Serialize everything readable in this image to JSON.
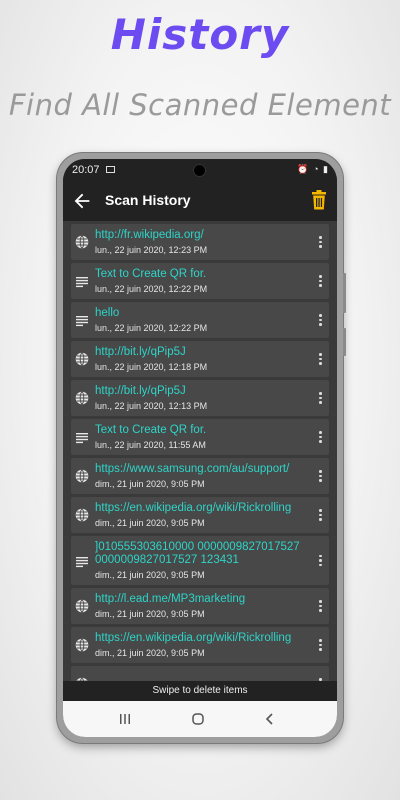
{
  "promo": {
    "title": "History",
    "subtitle": "Find All Scanned Element"
  },
  "status_bar": {
    "time": "20:07",
    "right": "⏰ ◔ ▮"
  },
  "app_bar": {
    "title": "Scan History",
    "accent_color": "#f5b800"
  },
  "colors": {
    "item_text": "#2ed4c8",
    "promo_title": "#6c4cf0"
  },
  "history": [
    {
      "icon": "globe-icon",
      "text": "http://fr.wikipedia.org/",
      "date": "lun., 22 juin 2020, 12:23 PM"
    },
    {
      "icon": "text-lines-icon",
      "text": "Text to Create QR for.",
      "date": "lun., 22 juin 2020, 12:22 PM"
    },
    {
      "icon": "text-lines-icon",
      "text": "hello",
      "date": "lun., 22 juin 2020, 12:22 PM"
    },
    {
      "icon": "globe-icon",
      "text": "http://bit.ly/qPip5J",
      "date": "lun., 22 juin 2020, 12:18 PM"
    },
    {
      "icon": "globe-icon",
      "text": "http://bit.ly/qPip5J",
      "date": "lun., 22 juin 2020, 12:13 PM"
    },
    {
      "icon": "text-lines-icon",
      "text": "Text to Create QR for.",
      "date": "lun., 22 juin 2020, 11:55 AM"
    },
    {
      "icon": "globe-icon",
      "text": "https://www.samsung.com/au/support/",
      "date": "dim., 21 juin 2020, 9:05 PM"
    },
    {
      "icon": "globe-icon",
      "text": "https://en.wikipedia.org/wiki/Rickrolling",
      "date": "dim., 21 juin 2020, 9:05 PM"
    },
    {
      "icon": "text-lines-icon",
      "text": "]010555303610000 0000009827017527 0000009827017527 123431",
      "date": "dim., 21 juin 2020, 9:05 PM"
    },
    {
      "icon": "globe-icon",
      "text": "http://l.ead.me/MP3marketing",
      "date": "dim., 21 juin 2020, 9:05 PM"
    },
    {
      "icon": "globe-icon",
      "text": "https://en.wikipedia.org/wiki/Rickrolling",
      "date": "dim., 21 juin 2020, 9:05 PM"
    },
    {
      "icon": "globe-icon",
      "text": "",
      "date": ""
    }
  ],
  "footer": {
    "hint": "Swipe to delete items"
  }
}
